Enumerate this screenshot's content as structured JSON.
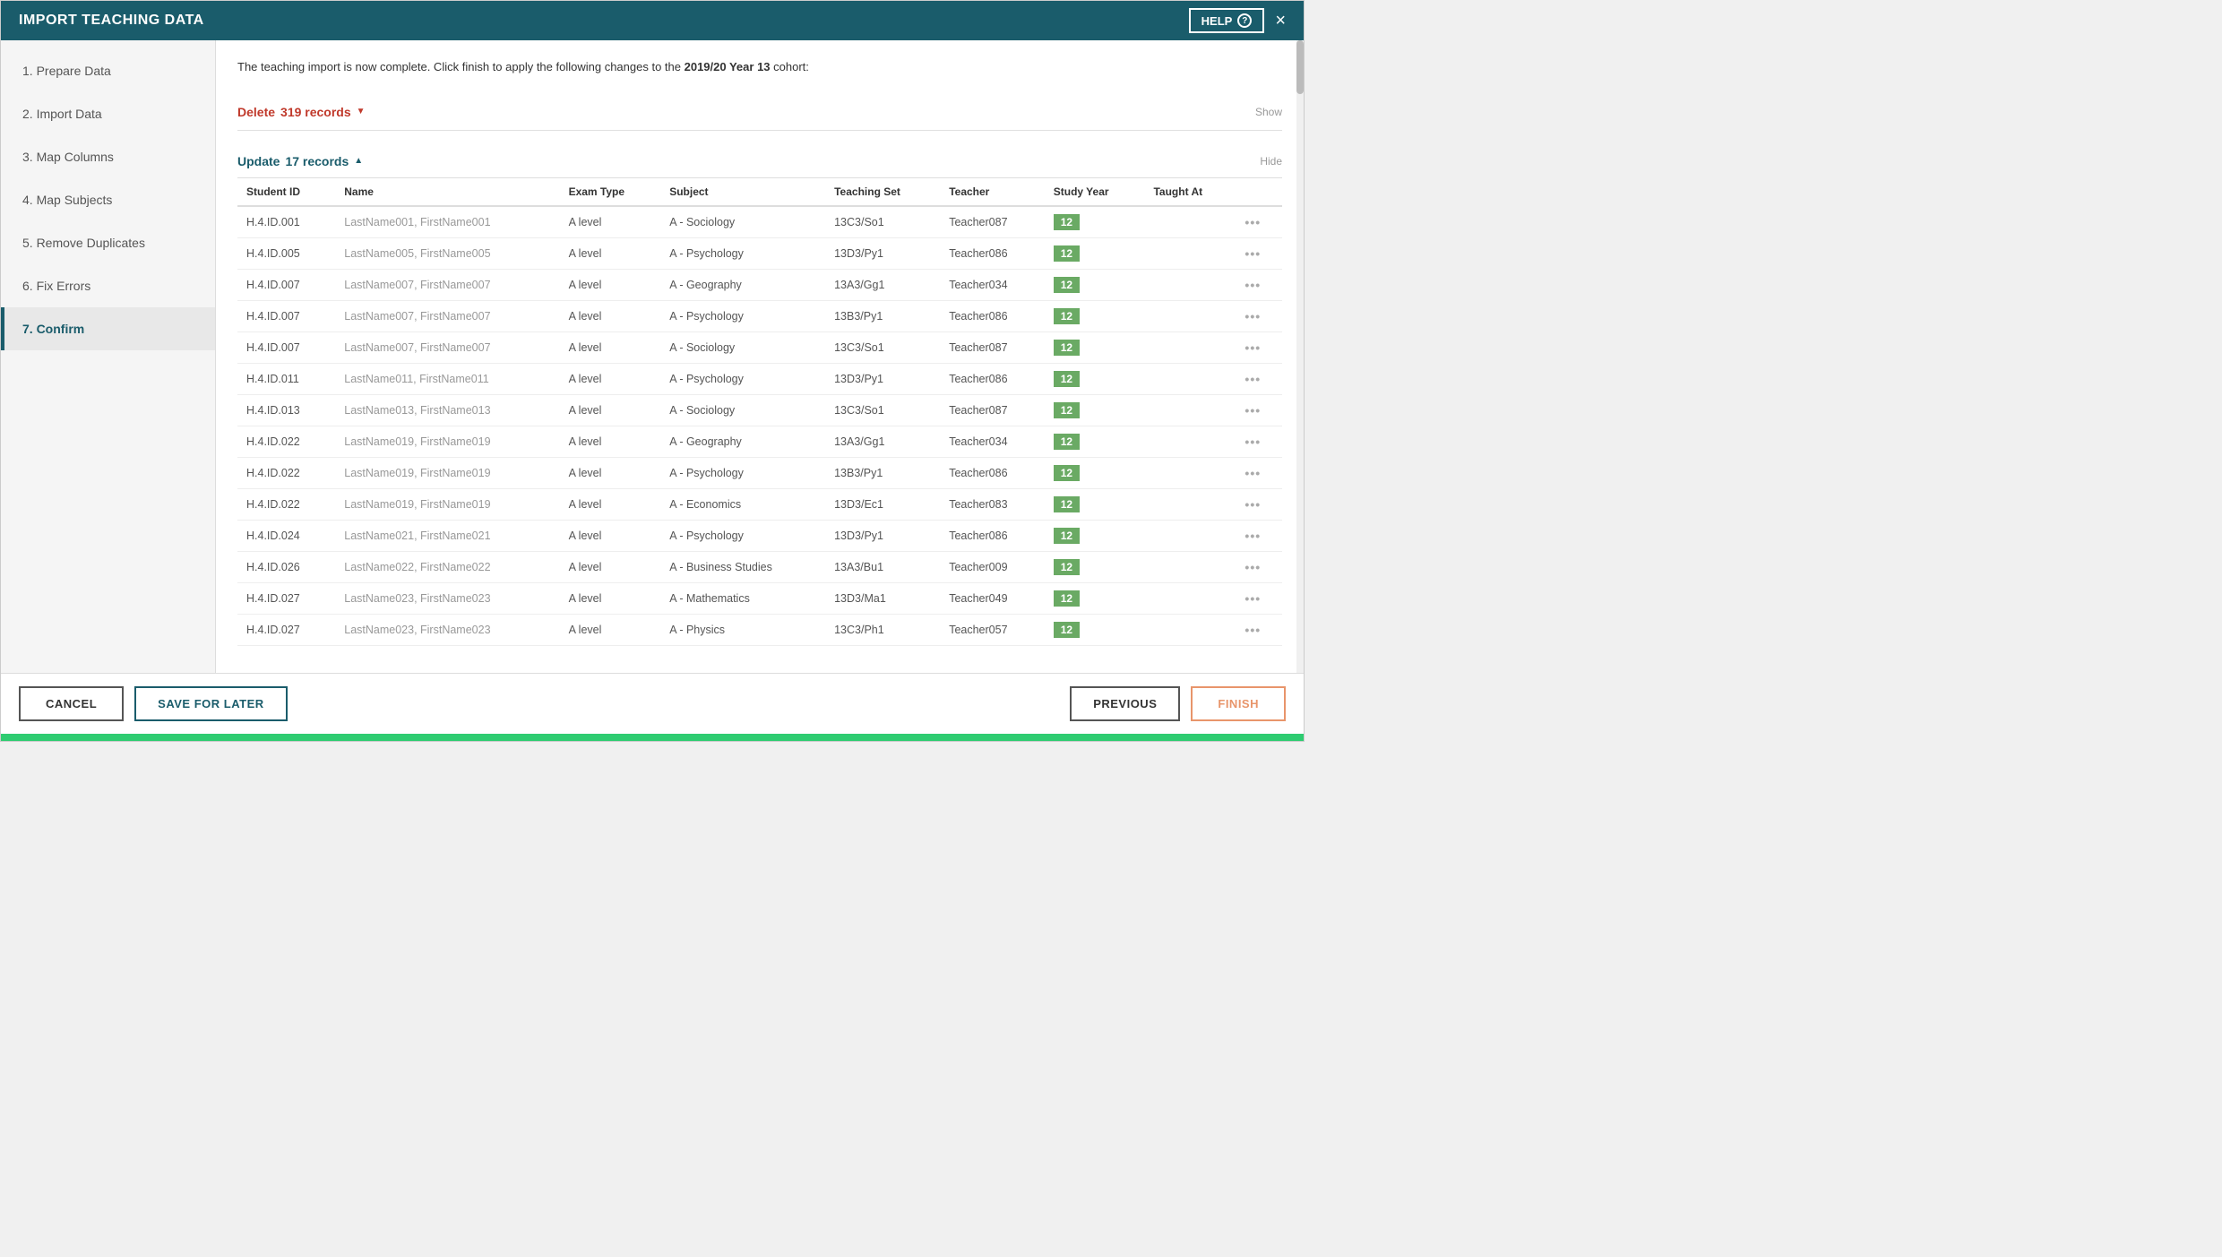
{
  "modal": {
    "title": "IMPORT TEACHING DATA",
    "help_label": "HELP",
    "close_label": "×"
  },
  "sidebar": {
    "items": [
      {
        "id": "prepare",
        "label": "1. Prepare Data",
        "state": "done"
      },
      {
        "id": "import",
        "label": "2. Import Data",
        "state": "done"
      },
      {
        "id": "map-columns",
        "label": "3. Map Columns",
        "state": "done"
      },
      {
        "id": "map-subjects",
        "label": "4. Map Subjects",
        "state": "done"
      },
      {
        "id": "remove-duplicates",
        "label": "5. Remove Duplicates",
        "state": "done"
      },
      {
        "id": "fix-errors",
        "label": "6. Fix Errors",
        "state": "done"
      },
      {
        "id": "confirm",
        "label": "7. Confirm",
        "state": "active"
      }
    ]
  },
  "content": {
    "intro": "The teaching import is now complete. Click finish to apply the following changes to the ",
    "cohort_bold": "2019/20 Year 13",
    "intro_end": " cohort:",
    "delete_section": {
      "label": "Delete ",
      "count": "319 records",
      "chevron": "▼",
      "show_label": "Show"
    },
    "update_section": {
      "label": "Update ",
      "count": "17 records",
      "chevron": "▲",
      "hide_label": "Hide"
    },
    "table": {
      "columns": [
        "Student ID",
        "Name",
        "Exam Type",
        "Subject",
        "Teaching Set",
        "Teacher",
        "Study Year",
        "Taught At"
      ],
      "rows": [
        {
          "student_id": "H.4.ID.001",
          "name": "LastName001, FirstName001",
          "exam_type": "A level",
          "subject": "A - Sociology",
          "teaching_set": "13C3/So1",
          "teacher": "Teacher087",
          "study_year": "12",
          "taught_at": ""
        },
        {
          "student_id": "H.4.ID.005",
          "name": "LastName005, FirstName005",
          "exam_type": "A level",
          "subject": "A - Psychology",
          "teaching_set": "13D3/Py1",
          "teacher": "Teacher086",
          "study_year": "12",
          "taught_at": ""
        },
        {
          "student_id": "H.4.ID.007",
          "name": "LastName007, FirstName007",
          "exam_type": "A level",
          "subject": "A - Geography",
          "teaching_set": "13A3/Gg1",
          "teacher": "Teacher034",
          "study_year": "12",
          "taught_at": ""
        },
        {
          "student_id": "H.4.ID.007",
          "name": "LastName007, FirstName007",
          "exam_type": "A level",
          "subject": "A - Psychology",
          "teaching_set": "13B3/Py1",
          "teacher": "Teacher086",
          "study_year": "12",
          "taught_at": ""
        },
        {
          "student_id": "H.4.ID.007",
          "name": "LastName007, FirstName007",
          "exam_type": "A level",
          "subject": "A - Sociology",
          "teaching_set": "13C3/So1",
          "teacher": "Teacher087",
          "study_year": "12",
          "taught_at": ""
        },
        {
          "student_id": "H.4.ID.011",
          "name": "LastName011, FirstName011",
          "exam_type": "A level",
          "subject": "A - Psychology",
          "teaching_set": "13D3/Py1",
          "teacher": "Teacher086",
          "study_year": "12",
          "taught_at": ""
        },
        {
          "student_id": "H.4.ID.013",
          "name": "LastName013, FirstName013",
          "exam_type": "A level",
          "subject": "A - Sociology",
          "teaching_set": "13C3/So1",
          "teacher": "Teacher087",
          "study_year": "12",
          "taught_at": ""
        },
        {
          "student_id": "H.4.ID.022",
          "name": "LastName019, FirstName019",
          "exam_type": "A level",
          "subject": "A - Geography",
          "teaching_set": "13A3/Gg1",
          "teacher": "Teacher034",
          "study_year": "12",
          "taught_at": ""
        },
        {
          "student_id": "H.4.ID.022",
          "name": "LastName019, FirstName019",
          "exam_type": "A level",
          "subject": "A - Psychology",
          "teaching_set": "13B3/Py1",
          "teacher": "Teacher086",
          "study_year": "12",
          "taught_at": ""
        },
        {
          "student_id": "H.4.ID.022",
          "name": "LastName019, FirstName019",
          "exam_type": "A level",
          "subject": "A - Economics",
          "teaching_set": "13D3/Ec1",
          "teacher": "Teacher083",
          "study_year": "12",
          "taught_at": ""
        },
        {
          "student_id": "H.4.ID.024",
          "name": "LastName021, FirstName021",
          "exam_type": "A level",
          "subject": "A - Psychology",
          "teaching_set": "13D3/Py1",
          "teacher": "Teacher086",
          "study_year": "12",
          "taught_at": ""
        },
        {
          "student_id": "H.4.ID.026",
          "name": "LastName022, FirstName022",
          "exam_type": "A level",
          "subject": "A - Business Studies",
          "teaching_set": "13A3/Bu1",
          "teacher": "Teacher009",
          "study_year": "12",
          "taught_at": ""
        },
        {
          "student_id": "H.4.ID.027",
          "name": "LastName023, FirstName023",
          "exam_type": "A level",
          "subject": "A - Mathematics",
          "teaching_set": "13D3/Ma1",
          "teacher": "Teacher049",
          "study_year": "12",
          "taught_at": ""
        },
        {
          "student_id": "H.4.ID.027",
          "name": "LastName023, FirstName023",
          "exam_type": "A level",
          "subject": "A - Physics",
          "teaching_set": "13C3/Ph1",
          "teacher": "Teacher057",
          "study_year": "12",
          "taught_at": ""
        }
      ]
    }
  },
  "footer": {
    "cancel_label": "CANCEL",
    "save_later_label": "SAVE FOR LATER",
    "previous_label": "PREVIOUS",
    "finish_label": "FINISH"
  },
  "colors": {
    "header_bg": "#1a5c6b",
    "study_year_bg": "#6aaa64",
    "delete_color": "#c0392b",
    "update_color": "#1a5c6b",
    "finish_border": "#e8956b"
  }
}
